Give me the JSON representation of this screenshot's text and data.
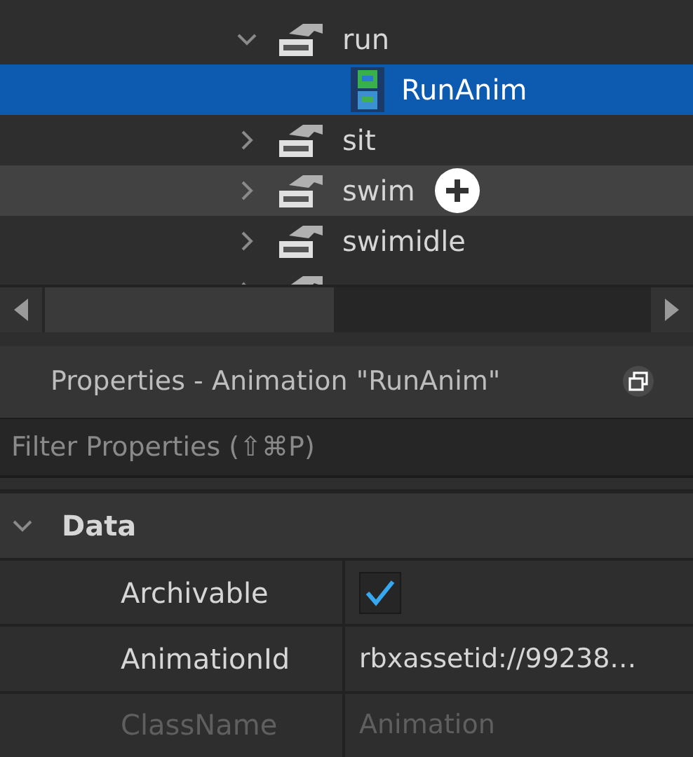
{
  "tree": {
    "items": [
      {
        "label": "run",
        "expanded": true,
        "selected": false,
        "hovered": false,
        "children": [
          {
            "label": "RunAnim",
            "kind": "animation",
            "selected": true,
            "hovered": false
          }
        ]
      },
      {
        "label": "sit",
        "expanded": false,
        "selected": false,
        "hovered": false
      },
      {
        "label": "swim",
        "expanded": false,
        "selected": false,
        "hovered": true
      },
      {
        "label": "swimidle",
        "expanded": false,
        "selected": false,
        "hovered": false
      },
      {
        "expanded": false,
        "selected": false,
        "hovered": false
      }
    ]
  },
  "properties": {
    "title": "Properties - Animation \"RunAnim\"",
    "filter": {
      "placeholder": "Filter Properties (⇧⌘P)"
    },
    "sections": [
      {
        "label": "Data",
        "expanded": true,
        "rows": [
          {
            "name": "Archivable",
            "kind": "checkbox",
            "checked": true,
            "disabled": false
          },
          {
            "name": "AnimationId",
            "kind": "text",
            "value": "rbxassetid://99238…",
            "disabled": false
          },
          {
            "name": "ClassName",
            "kind": "text",
            "value": "Animation",
            "disabled": true
          }
        ]
      }
    ]
  }
}
